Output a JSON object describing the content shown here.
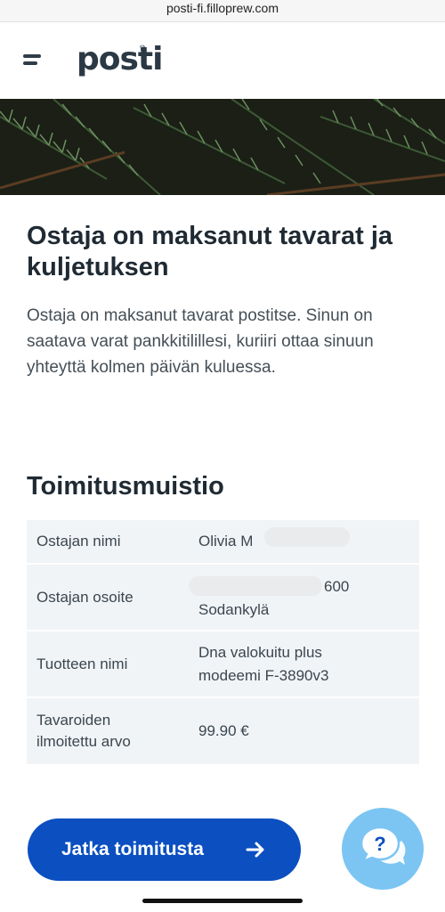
{
  "browser": {
    "url": "posti-fi.filloprew.com"
  },
  "header": {
    "logo_text": "posti",
    "menu_icon": "hamburger-icon"
  },
  "hero": {
    "image": "pine-branches"
  },
  "main": {
    "title": "Ostaja on maksanut tavarat ja kuljetuksen",
    "description": "Ostaja on maksanut tavarat postitse. Sinun on saatava varat pankkitilillesi, kuriiri ottaa sinuun yhteyttä kolmen päivän kuluessa."
  },
  "delivery": {
    "heading": "Toimitusmuistio",
    "rows": [
      {
        "label": "Ostajan nimi",
        "value_line1": "Olivia M",
        "value_line2": ""
      },
      {
        "label": "Ostajan osoite",
        "value_line1": "600",
        "value_line2": "Sodankylä"
      },
      {
        "label": "Tuotteen nimi",
        "value_line1": "Dna valokuitu plus",
        "value_line2": "modeemi F-3890v3"
      },
      {
        "label_line1": "Tavaroiden",
        "label_line2": "ilmoitettu arvo",
        "value_line1": "99.90 €"
      }
    ]
  },
  "cta": {
    "label": "Jatka toimitusta",
    "icon": "arrow-right-icon"
  },
  "chat": {
    "icon": "chat-help-icon"
  },
  "colors": {
    "primary": "#0b4fc0",
    "chat_bg": "#7cc5f3",
    "row_bg": "#f1f4f7",
    "text": "#1f2a33"
  }
}
